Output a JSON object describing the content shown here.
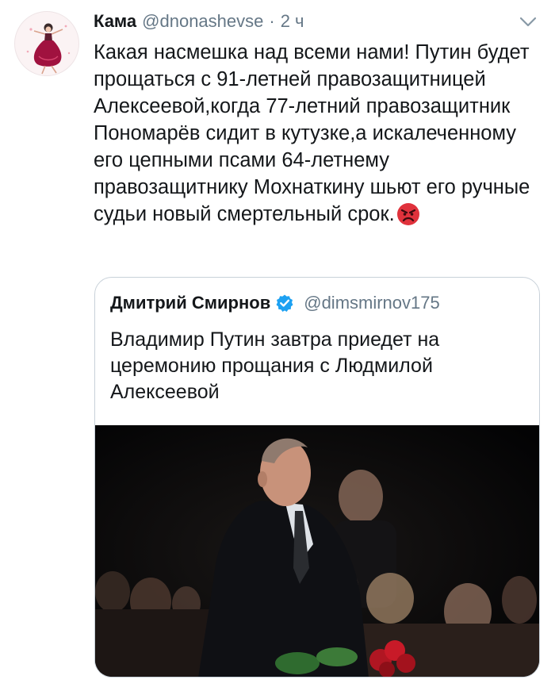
{
  "tweet": {
    "display_name": "Кама",
    "handle": "@dnonashevse",
    "separator": "·",
    "time": "2 ч",
    "text": "Какая насмешка над всеми нами! Путин будет прощаться с 91-летней правозащитницей Алексеевой,когда 77-летний правозащитник Пономарёв сидит в кутузке,а искалеченному его цепными псами 64-летнему правозащитнику Мохнаткину шьют его ручные судьи новый смертельный срок.",
    "emoji": "angry-face-icon",
    "avatar_icon": "dancer-illustration-avatar",
    "menu_icon": "chevron-down-icon"
  },
  "quoted_tweet": {
    "display_name": "Дмитрий Смирнов",
    "verified_icon": "verified-badge-icon",
    "handle": "@dimsmirnov175",
    "text": "Владимир Путин завтра приедет на церемонию прощания с Людмилой Алексеевой",
    "photo": "photo-man-in-dark-suit-holding-red-roses-crowd-background"
  },
  "colors": {
    "text_primary": "#14171a",
    "text_secondary": "#657786",
    "verified_blue": "#1da1f2",
    "quote_border": "#c8d1d9",
    "emoji_red": "#e0323c"
  }
}
